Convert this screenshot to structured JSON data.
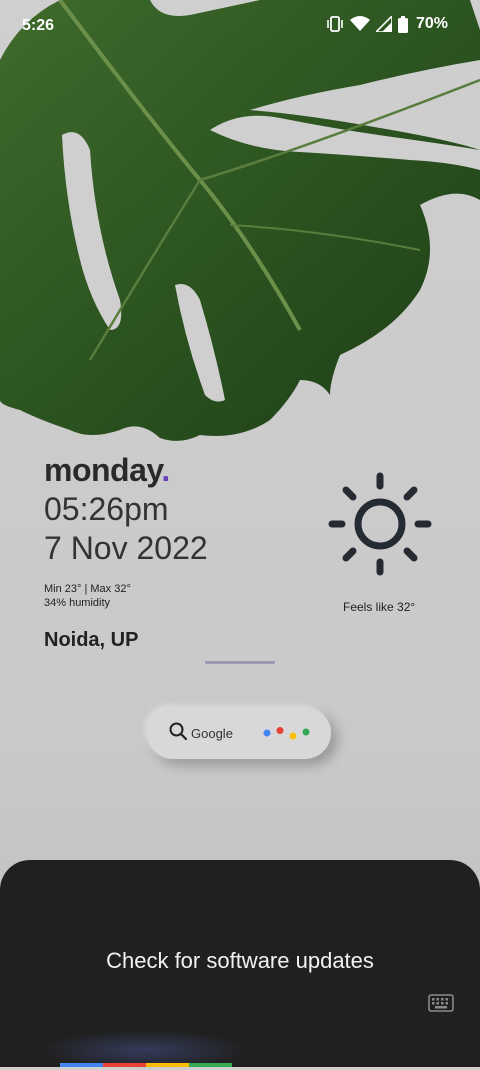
{
  "status_bar": {
    "time": "5:26",
    "battery": "70%",
    "icons": [
      "vibrate-icon",
      "wifi-icon",
      "signal-icon",
      "battery-icon"
    ]
  },
  "widget": {
    "day": "monday",
    "day_dot": ".",
    "time": "05:26pm",
    "date": "7 Nov 2022",
    "min_max": "Min 23° | Max 32°",
    "humidity": "34% humidity",
    "city": "Noida, UP",
    "feels_like": "Feels like 32°",
    "weather_icon": "sun-icon"
  },
  "search": {
    "label": "Google",
    "icon": "search-icon"
  },
  "sheet": {
    "title": "Check for software updates",
    "keyboard_icon": "keyboard-icon"
  },
  "colors": {
    "accent_dot": "#6a3fb5",
    "google_blue": "#4285f4",
    "google_red": "#ea4335",
    "google_yellow": "#fbbc05",
    "google_green": "#34a853",
    "sheet_bg": "#202020"
  }
}
